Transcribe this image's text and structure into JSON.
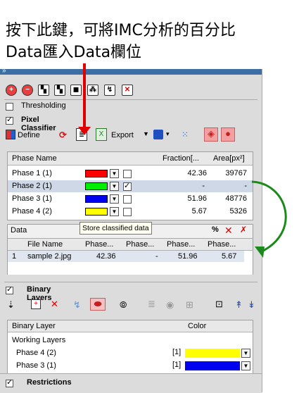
{
  "caption": {
    "line1": "按下此鍵，可將IMC分析的百分比",
    "line2": "Data匯入Data欄位"
  },
  "panel_sections": {
    "thresholding": "Thresholding",
    "pixel_classifier": "Pixel Classifier",
    "binary_layers": "Binary Layers",
    "restrictions": "Restrictions"
  },
  "toolbar": {
    "define_label": "Define",
    "export_label": "Export",
    "tooltip": "Store classified data"
  },
  "phase_table": {
    "headers": [
      "Phase Name",
      "Fraction[...",
      "Area[px²]"
    ],
    "rows": [
      {
        "name": "Phase 1 (1)",
        "color": "#ff0000",
        "checked": false,
        "fraction": "42.36",
        "area": "39767"
      },
      {
        "name": "Phase 2 (1)",
        "color": "#00ee00",
        "checked": true,
        "fraction": "-",
        "area": "-"
      },
      {
        "name": "Phase 3 (1)",
        "color": "#0000ee",
        "checked": false,
        "fraction": "51.96",
        "area": "48776"
      },
      {
        "name": "Phase 4 (2)",
        "color": "#ffff00",
        "checked": false,
        "fraction": "5.67",
        "area": "5326"
      }
    ]
  },
  "data_panel": {
    "title": "Data",
    "headers": [
      "File Name",
      "Phase...",
      "Phase...",
      "Phase...",
      "Phase..."
    ],
    "row": {
      "index": "1",
      "file": "sample 2.jpg",
      "v1": "42.36",
      "v2": "-",
      "v3": "51.96",
      "v4": "5.67"
    }
  },
  "binary_table": {
    "headers": [
      "Binary Layer",
      "Color"
    ],
    "group": "Working Layers",
    "rows": [
      {
        "name": "Phase 4 (2)",
        "tag": "[1]",
        "color": "#ffff00"
      },
      {
        "name": "Phase 3 (1)",
        "tag": "[1]",
        "color": "#0000ee"
      }
    ]
  }
}
